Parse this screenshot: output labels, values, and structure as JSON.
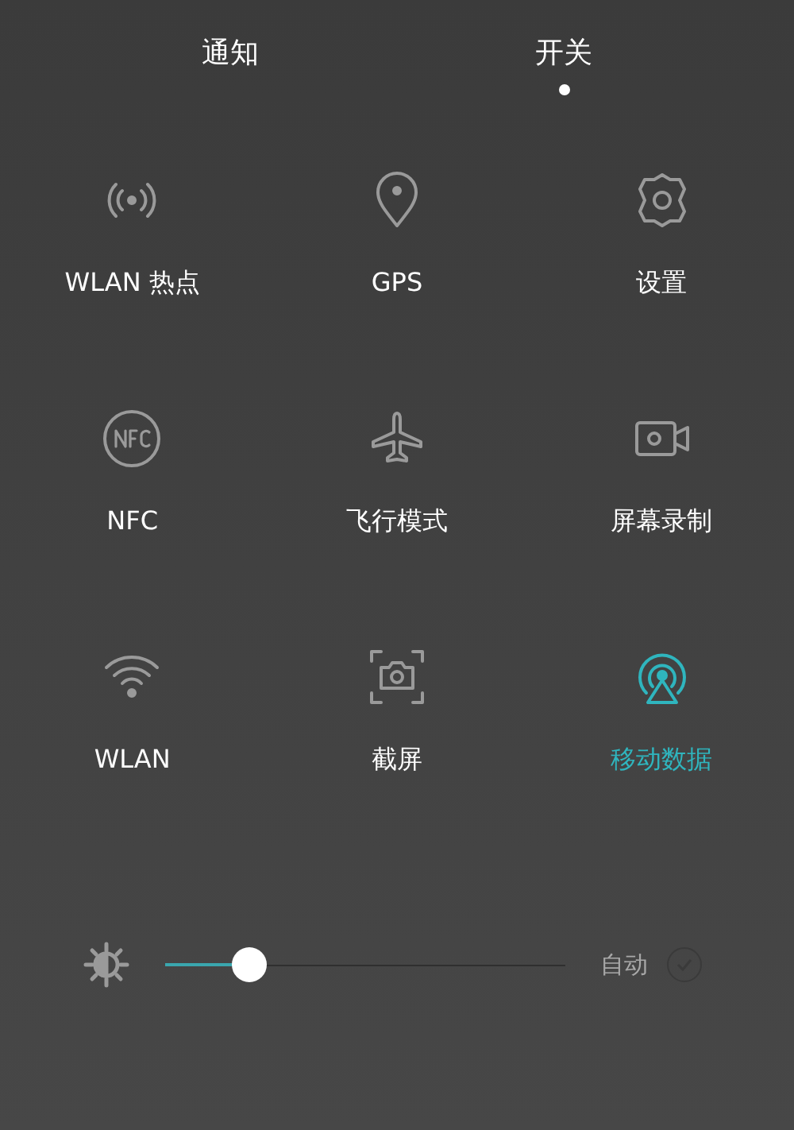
{
  "tabs": [
    {
      "label": "通知",
      "selected": false
    },
    {
      "label": "开关",
      "selected": true
    }
  ],
  "toggles": [
    {
      "kind": "hotspot",
      "label": "WLAN 热点",
      "on": false
    },
    {
      "kind": "gps",
      "label": "GPS",
      "on": false
    },
    {
      "kind": "settings",
      "label": "设置",
      "on": false
    },
    {
      "kind": "nfc",
      "label": "NFC",
      "on": false
    },
    {
      "kind": "airplane",
      "label": "飞行模式",
      "on": false
    },
    {
      "kind": "record",
      "label": "屏幕录制",
      "on": false
    },
    {
      "kind": "wifi",
      "label": "WLAN",
      "on": false
    },
    {
      "kind": "screenshot",
      "label": "截屏",
      "on": false
    },
    {
      "kind": "data",
      "label": "移动数据",
      "on": true
    }
  ],
  "brightness": {
    "level": 0.21,
    "auto_label": "自动",
    "auto_checked": false
  }
}
